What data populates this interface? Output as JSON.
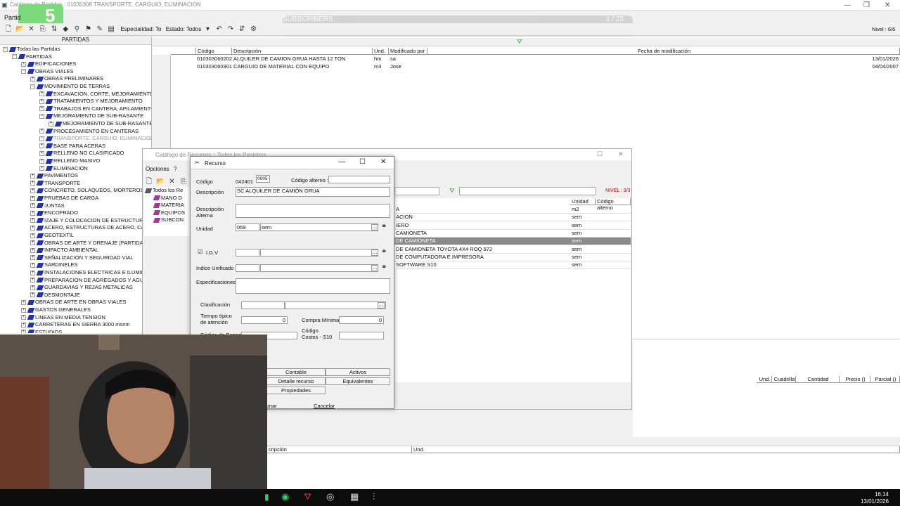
{
  "window": {
    "title": "Catálogo de Partidas : 01030306  TRANSPORTE, CARGUIO, ELIMINACION"
  },
  "overlay": {
    "logo_char": "5",
    "subscribers": "SUBSCRIBERS",
    "counter": "1 / 25"
  },
  "menu": {
    "item1": "Partid"
  },
  "toolbar": {
    "especialidad_label": "Especialidad: To",
    "estado_label": "Estado: Todos",
    "nivel": "Nivel : 6/6"
  },
  "tree": {
    "header": "PARTIDAS",
    "nodes": [
      {
        "label": "Todas las Partidas"
      },
      {
        "label": "PARTIDAS"
      },
      {
        "label": "EDIFICACIONES"
      },
      {
        "label": "OBRAS VIALES"
      },
      {
        "label": "OBRAS PRELIMINARES"
      },
      {
        "label": "MOVIMIENTO DE TERRAS"
      },
      {
        "label": "EXCAVACION, CORTE, MEJORAMIENTO"
      },
      {
        "label": "TRATAMIENTOS Y MEJORAMIENTO"
      },
      {
        "label": "TRABAJOS EN CANTERA, APILAMIENTO,"
      },
      {
        "label": "MEJORAMIENTO DE SUB-RASANTE"
      },
      {
        "label": "MEJORAMIENTO DE SUB-RASANTE"
      },
      {
        "label": "PROCESAMIENTO EN CANTERAS"
      },
      {
        "label": "TRANSPORTE, CARGUIO, ELIMINACION"
      },
      {
        "label": "BASE PARA ACERAS"
      },
      {
        "label": "RELLENO NO CLASIFICADO"
      },
      {
        "label": "RELLENO MASIVO"
      },
      {
        "label": "ELIMINACION"
      },
      {
        "label": "PAVIMENTOS"
      },
      {
        "label": "TRANSPORTE"
      },
      {
        "label": "CONCRETO, SOLAQUEOS, MORTEROS"
      },
      {
        "label": "PRUEBAS DE CARGA"
      },
      {
        "label": "JUNTAS"
      },
      {
        "label": "ENCOFRADO"
      },
      {
        "label": "IZAJE Y COLOCACION DE ESTRUCTURAS"
      },
      {
        "label": "ACERO, ESTRUCTURAS DE ACERO, CARP"
      },
      {
        "label": "GEOTEXTIL"
      },
      {
        "label": "OBRAS DE ARTE Y DRENAJE (PARTIDAS"
      },
      {
        "label": "IMPACTO AMBIENTAL"
      },
      {
        "label": "SEÑALIZACION Y SEGURIDAD VIAL"
      },
      {
        "label": "SARDINELES"
      },
      {
        "label": "INSTALACIONES ELECTRICAS E ILUMINAC"
      },
      {
        "label": "PREPARACION DE AGREGADOS Y AGUA"
      },
      {
        "label": "GUARDAVIAS Y REJAS METALICAS"
      },
      {
        "label": "DESMONTAJE"
      },
      {
        "label": "OBRAS DE ARTE EN OBRAS VIALES"
      },
      {
        "label": "GASTOS GENERALES"
      },
      {
        "label": "LINEAS EN MEDIA TENSION"
      },
      {
        "label": "CARRETERAS EN SIERRA 3000 msnm"
      },
      {
        "label": "ESTUDIOS"
      }
    ]
  },
  "grid": {
    "columns": {
      "codigo": "Código",
      "descripcion": "Descripción",
      "und": "Und.",
      "modificado": "Modificado por",
      "fecha": "Fecha de modificación"
    },
    "rows": [
      {
        "codigo": "010303060202",
        "descripcion": "ALQUILER DE CAMION GRUA HASTA 12 TON",
        "und": "hm",
        "modificado": "sa",
        "fecha": "13/01/2026"
      },
      {
        "codigo": "010303060301",
        "descripcion": "CARGUIO DE MATERIAL CON EQUIPO",
        "und": "m3",
        "modificado": "Jose",
        "fecha": "04/04/2007"
      }
    ]
  },
  "catalog": {
    "title": "Catálogo de Recursos :: Todos los Registros",
    "menu_opciones": "Opciones",
    "menu_help": "?",
    "tree": [
      "Todos los Re",
      "MANO D",
      "MATERIA",
      "EQUIPOS",
      "SUBCON"
    ],
    "nivel": "NIVEL : 3/3",
    "columns": {
      "unidad": "Unidad",
      "codigo_alterno": "Código alterno"
    },
    "rows": [
      {
        "desc": "A",
        "unidad": "m2"
      },
      {
        "desc": "ACION",
        "unidad": "sem"
      },
      {
        "desc": "IERO",
        "unidad": "sem"
      },
      {
        "desc": "CAMIONETA",
        "unidad": "sem"
      },
      {
        "desc": "DE CAMIONETA",
        "unidad": "sem"
      },
      {
        "desc": "DE CAMIONETA TOYOTA 4X4 ROQ 972",
        "unidad": "sem"
      },
      {
        "desc": "DE COMPUTADORA E IMPRESORA",
        "unidad": "sem"
      },
      {
        "desc": "SOFTWARE S10",
        "unidad": "sem"
      }
    ]
  },
  "dialog": {
    "title": "Recurso",
    "codigo_label": "Código",
    "codigo_value": "042401",
    "codigo_suffix": "0005",
    "codigo_alterno_label": "Código alterno :",
    "descripcion_label": "Descripción",
    "descripcion_value": "SC ALQUILER DE CAMIÓN GRUA",
    "desc_alterna_label1": "Descripción",
    "desc_alterna_label2": "Alterna",
    "unidad_label": "Unidad",
    "unidad_code": "069",
    "unidad_value": "sem",
    "igv_label": "I.G.V",
    "indice_label": "Indice Unificado",
    "especificaciones_label": "Especificaciones",
    "clasificacion_label": "Clasificación",
    "tiempo_label1": "Tiempo típico",
    "tiempo_label2": "de atención",
    "tiempo_value": "0",
    "compra_label": "Compra Mínima",
    "compra_value": "0",
    "codigo_barras_label": "Código de Barras",
    "codigo_costos_label1": "Código",
    "codigo_costos_label2": "Costos - S10",
    "tabs": {
      "contable": "Contable",
      "activos": "Activos",
      "detalle": "Detalle recurso",
      "equivalentes": "Equivalentes",
      "propiedades": "Propiedades"
    },
    "btn_seleccionar": "ionar",
    "btn_cancelar": "Cancelar"
  },
  "right_panel": {
    "columns": [
      "Und.",
      "Cuadrilla",
      "Cantidad",
      "Precio ()",
      "Parcial ()"
    ]
  },
  "bottom_panel": {
    "col_desc": "cripción",
    "col_und": "Und."
  },
  "taskbar": {
    "time": "16:14",
    "date": "13/01/2026"
  }
}
